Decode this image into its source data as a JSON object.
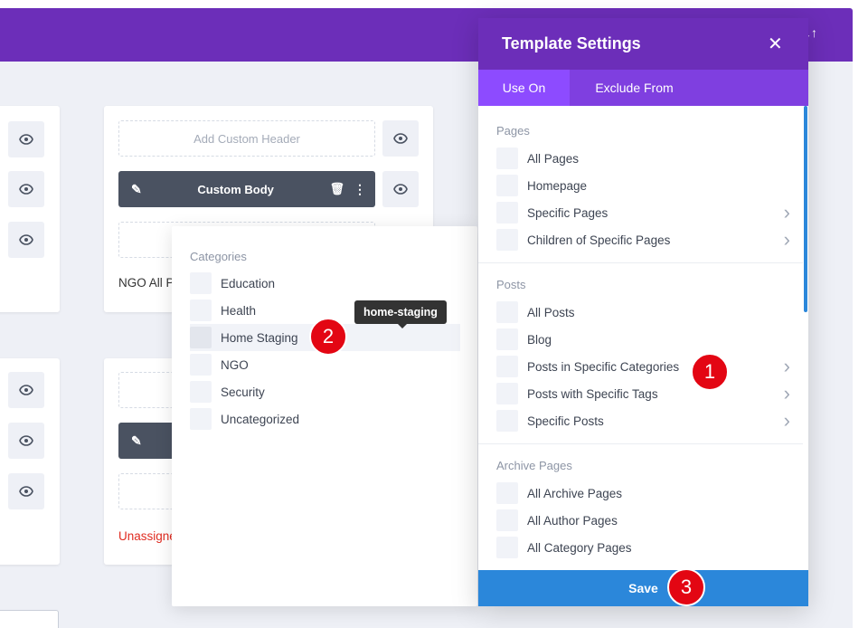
{
  "builder": {
    "card_right": {
      "add_header_label": "Add Custom Header",
      "body_label": "Custom Body",
      "template_name": "NGO All P",
      "template_name_2": "Unassigne"
    }
  },
  "categories_popup": {
    "section_title": "Categories",
    "items": [
      {
        "label": "Education",
        "highlighted": false
      },
      {
        "label": "Health",
        "highlighted": false
      },
      {
        "label": "Home Staging",
        "highlighted": true
      },
      {
        "label": "NGO",
        "highlighted": false
      },
      {
        "label": "Security",
        "highlighted": false
      },
      {
        "label": "Uncategorized",
        "highlighted": false
      }
    ],
    "tooltip": "home-staging"
  },
  "template_settings": {
    "title": "Template Settings",
    "close_icon": "close-icon",
    "tabs": [
      {
        "label": "Use On",
        "active": true
      },
      {
        "label": "Exclude From",
        "active": false
      }
    ],
    "sections": [
      {
        "title": "Pages",
        "items": [
          {
            "label": "All Pages",
            "chevron": false
          },
          {
            "label": "Homepage",
            "chevron": false
          },
          {
            "label": "Specific Pages",
            "chevron": true
          },
          {
            "label": "Children of Specific Pages",
            "chevron": true
          }
        ]
      },
      {
        "title": "Posts",
        "items": [
          {
            "label": "All Posts",
            "chevron": false
          },
          {
            "label": "Blog",
            "chevron": false
          },
          {
            "label": "Posts in Specific Categories",
            "chevron": true
          },
          {
            "label": "Posts with Specific Tags",
            "chevron": true
          },
          {
            "label": "Specific Posts",
            "chevron": true
          }
        ]
      },
      {
        "title": "Archive Pages",
        "items": [
          {
            "label": "All Archive Pages",
            "chevron": false
          },
          {
            "label": "All Author Pages",
            "chevron": false
          },
          {
            "label": "All Category Pages",
            "chevron": false
          }
        ]
      }
    ],
    "save_label": "Save"
  },
  "badges": [
    "1",
    "2",
    "3"
  ],
  "colors": {
    "purple": "#6c2eb9",
    "purple_tabs": "#7f3fe0",
    "blue": "#2b87da",
    "badge_red": "#e30613",
    "red_text": "#e02b20"
  }
}
